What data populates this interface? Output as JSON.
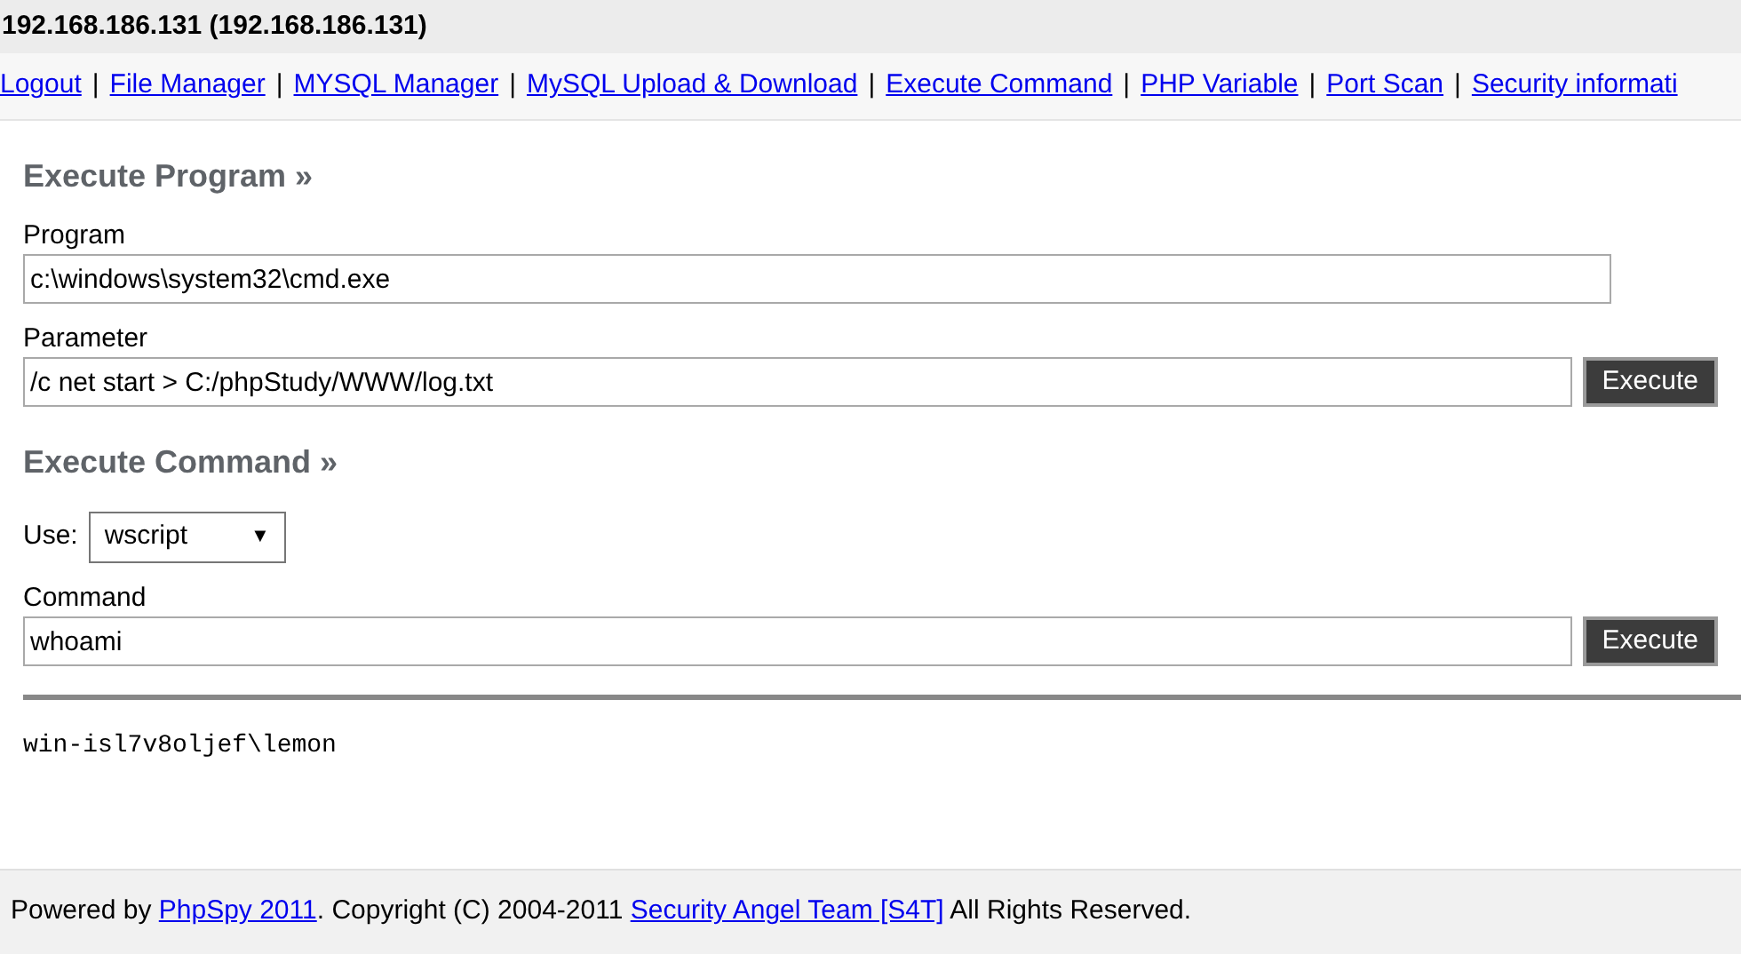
{
  "header": {
    "title": "192.168.186.131 (192.168.186.131)"
  },
  "nav": [
    {
      "label": "Logout"
    },
    {
      "separator": "|",
      "label": "File Manager"
    },
    {
      "separator": "|",
      "label": "MYSQL Manager"
    },
    {
      "separator": "|",
      "label": "MySQL Upload & Download"
    },
    {
      "separator": "|",
      "label": "Execute Command"
    },
    {
      "separator": "|",
      "label": "PHP Variable"
    },
    {
      "separator": "|",
      "label": "Port Scan"
    },
    {
      "separator": "|",
      "label": "Security informati"
    }
  ],
  "sections": [
    {
      "heading": "Execute Program »",
      "fields": [
        {
          "kind": "input",
          "label": "Program",
          "value": "c:\\windows\\system32\\cmd.exe"
        },
        {
          "kind": "input",
          "label": "Parameter",
          "value": "/c net start > C:/phpStudy/WWW/log.txt",
          "button": "Execute"
        }
      ]
    },
    {
      "heading": "Execute Command »",
      "fields": [
        {
          "kind": "select",
          "label": "Use:",
          "value": "wscript",
          "caret": "▼"
        },
        {
          "kind": "input",
          "label": "Command",
          "value": "whoami",
          "button": "Execute"
        }
      ]
    }
  ],
  "output": "win-isl7v8oljef\\lemon",
  "footer": {
    "prefix": "Powered by ",
    "link1": "PhpSpy 2011",
    "middle": ". Copyright (C) 2004-2011 ",
    "link2": "Security Angel Team [S4T]",
    "suffix": " All Rights Reserved."
  }
}
